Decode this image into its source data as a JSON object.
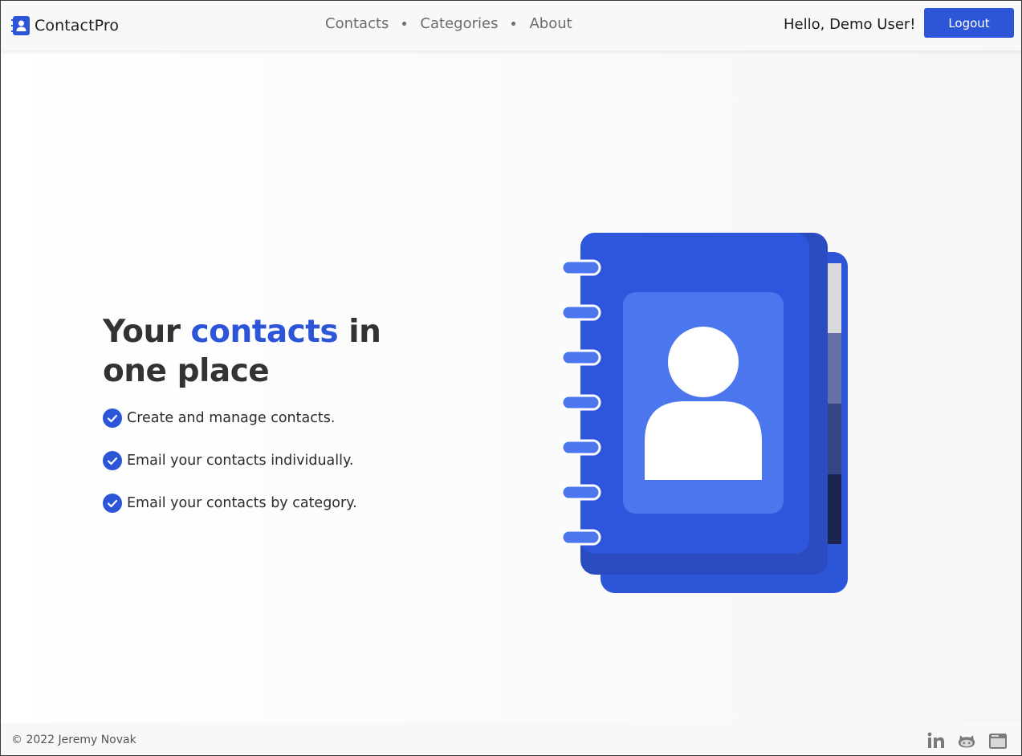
{
  "navbar": {
    "brand": "ContactPro",
    "links": [
      {
        "label": "Contacts"
      },
      {
        "label": "Categories"
      },
      {
        "label": "About"
      }
    ],
    "greeting": "Hello, Demo User!",
    "logout_label": "Logout"
  },
  "hero": {
    "title_part1": "Your ",
    "title_accent": "contacts",
    "title_part2": " in one place",
    "features": [
      "Create and manage contacts.",
      "Email your contacts individually.",
      "Email your contacts by category."
    ]
  },
  "footer": {
    "copyright": "© 2022 Jeremy Novak",
    "social_icons": [
      "linkedin-icon",
      "github-icon",
      "portfolio-icon"
    ]
  },
  "colors": {
    "primary": "#2c55d8",
    "text_dark": "#333333",
    "nav_link": "#6c6c6c"
  }
}
